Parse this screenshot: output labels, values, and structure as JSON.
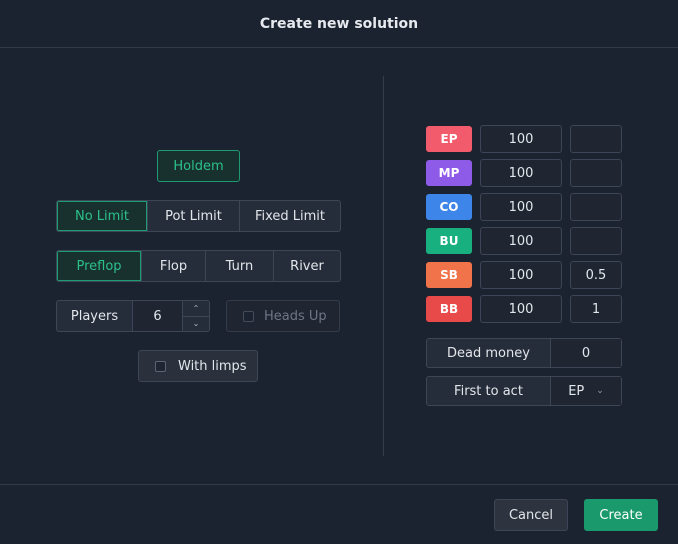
{
  "dialog": {
    "title": "Create new solution"
  },
  "game": {
    "label": "Holdem"
  },
  "limits": [
    {
      "label": "No Limit",
      "active": true
    },
    {
      "label": "Pot Limit",
      "active": false
    },
    {
      "label": "Fixed Limit",
      "active": false
    }
  ],
  "streets": [
    {
      "label": "Preflop",
      "active": true
    },
    {
      "label": "Flop",
      "active": false
    },
    {
      "label": "Turn",
      "active": false
    },
    {
      "label": "River",
      "active": false
    }
  ],
  "players": {
    "label": "Players",
    "value": "6"
  },
  "heads_up": {
    "label": "Heads Up",
    "checked": false,
    "disabled": true
  },
  "with_limps": {
    "label": "With limps",
    "checked": false
  },
  "positions": [
    {
      "name": "EP",
      "color": "#f25b6b",
      "stack": "100",
      "blind": ""
    },
    {
      "name": "MP",
      "color": "#8d5be8",
      "stack": "100",
      "blind": ""
    },
    {
      "name": "CO",
      "color": "#3d85e8",
      "stack": "100",
      "blind": ""
    },
    {
      "name": "BU",
      "color": "#17b07e",
      "stack": "100",
      "blind": ""
    },
    {
      "name": "SB",
      "color": "#f0734a",
      "stack": "100",
      "blind": "0.5"
    },
    {
      "name": "BB",
      "color": "#e84a4a",
      "stack": "100",
      "blind": "1"
    }
  ],
  "dead_money": {
    "label": "Dead money",
    "value": "0"
  },
  "first_to_act": {
    "label": "First to act",
    "value": "EP"
  },
  "footer": {
    "cancel_label": "Cancel",
    "create_label": "Create"
  },
  "colors": {
    "accent": "#1a9a6c",
    "background": "#1c2330"
  }
}
